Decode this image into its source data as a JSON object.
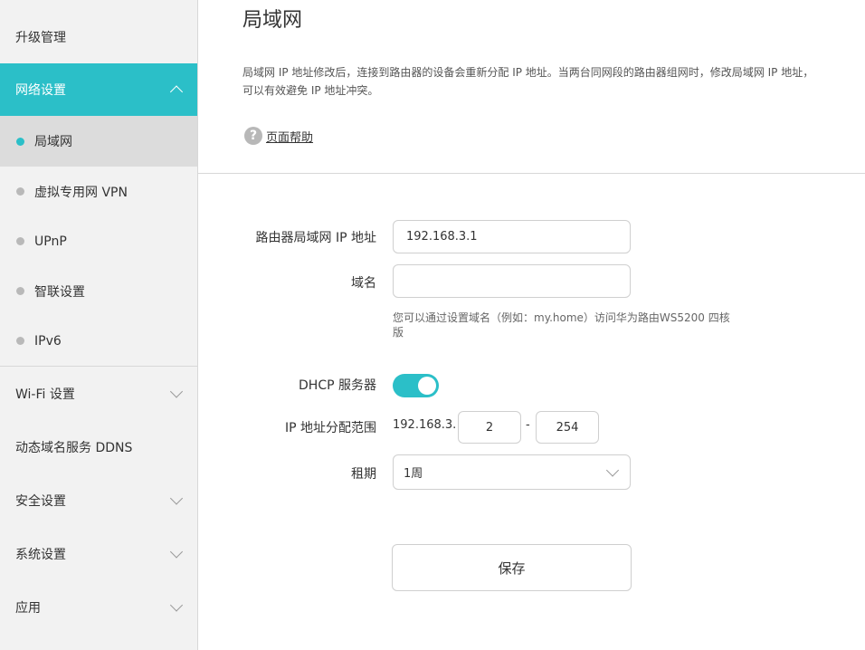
{
  "sidebar": {
    "items": [
      {
        "label": "升级管理"
      },
      {
        "label": "网络设置",
        "active": true,
        "expanded": true
      },
      {
        "label": "Wi-Fi 设置"
      },
      {
        "label": "动态域名服务 DDNS"
      },
      {
        "label": "安全设置"
      },
      {
        "label": "系统设置"
      },
      {
        "label": "应用"
      }
    ],
    "sub_items": [
      {
        "label": "局域网",
        "current": true
      },
      {
        "label": "虚拟专用网 VPN"
      },
      {
        "label": "UPnP"
      },
      {
        "label": "智联设置"
      },
      {
        "label": "IPv6"
      }
    ]
  },
  "main": {
    "title": "局域网",
    "description": "局域网 IP 地址修改后，连接到路由器的设备会重新分配 IP 地址。当两台同网段的路由器组网时，修改局域网 IP 地址，可以有效避免 IP 地址冲突。",
    "help_icon": "?",
    "help_label": "页面帮助",
    "form": {
      "lan_ip_label": "路由器局域网 IP 地址",
      "lan_ip_value": "192.168.3.1",
      "domain_label": "域名",
      "domain_value": "",
      "domain_hint": "您可以通过设置域名（例如：my.home）访问华为路由WS5200 四核版",
      "dhcp_label": "DHCP 服务器",
      "dhcp_enabled": true,
      "range_label": "IP 地址分配范围",
      "range_prefix": "192.168.3.",
      "range_start": "2",
      "range_separator": "-",
      "range_end": "254",
      "lease_label": "租期",
      "lease_value": "1周",
      "save_label": "保存"
    }
  },
  "colors": {
    "accent": "#2bbfc8",
    "sidebar_bg": "#f2f2f2",
    "current_sub_bg": "#dcdcdc"
  }
}
